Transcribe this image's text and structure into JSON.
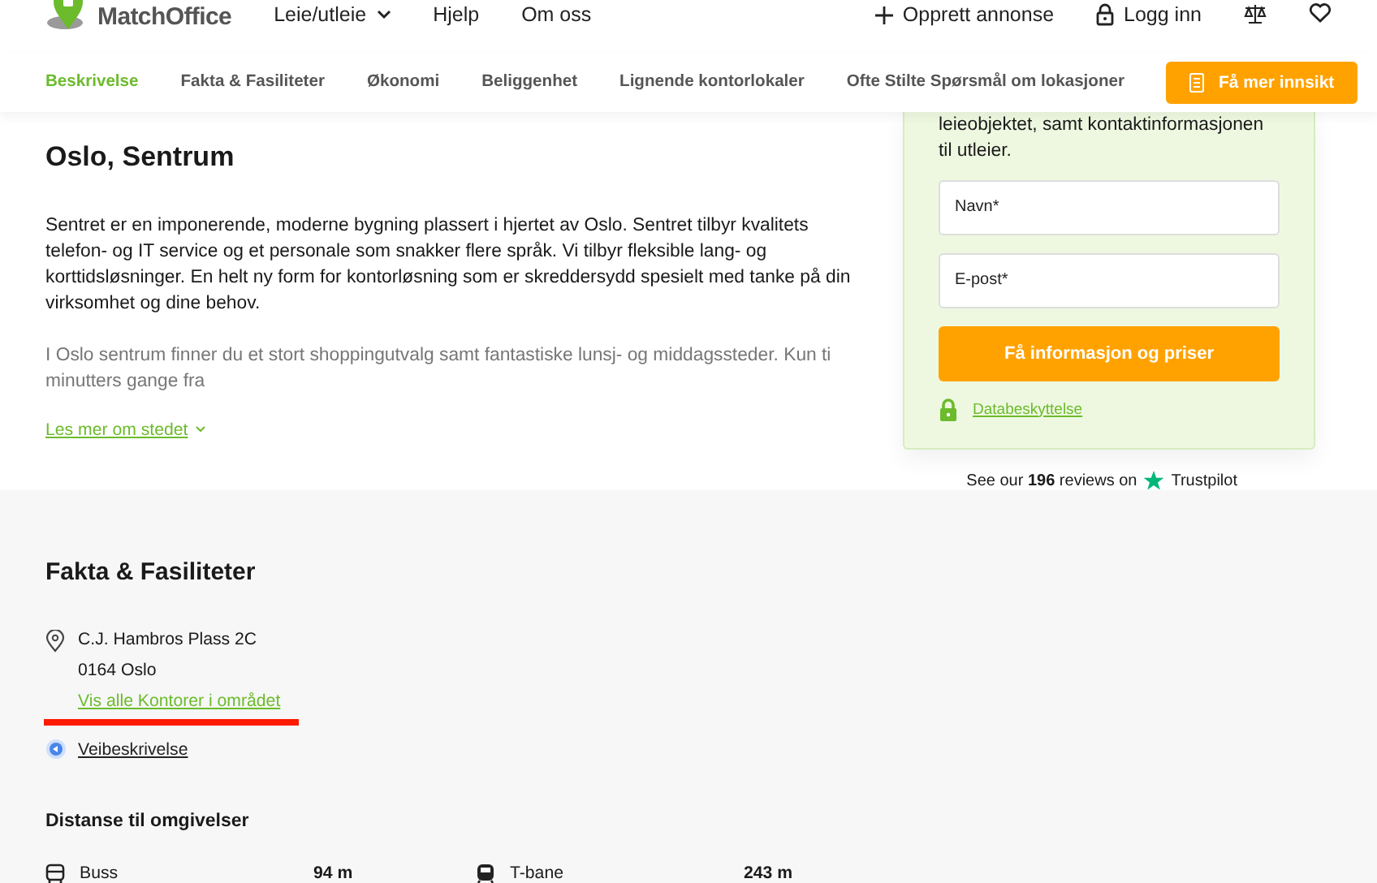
{
  "header": {
    "logo": "MatchOffice",
    "menu": [
      {
        "label": "Leie/utleie",
        "dropdown": true
      },
      {
        "label": "Hjelp",
        "dropdown": false
      },
      {
        "label": "Om oss",
        "dropdown": false
      }
    ],
    "actions": [
      {
        "kind": "add",
        "label": "Opprett annonse"
      },
      {
        "kind": "login",
        "label": "Logg inn"
      },
      {
        "kind": "compare"
      },
      {
        "kind": "favorite"
      }
    ]
  },
  "subnav": {
    "tabs": [
      {
        "label": "Beskrivelse",
        "selected": true
      },
      {
        "label": "Fakta & Fasiliteter",
        "selected": false
      },
      {
        "label": "Økonomi",
        "selected": false
      },
      {
        "label": "Beliggenhet",
        "selected": false
      },
      {
        "label": "Lignende kontorlokaler",
        "selected": false
      },
      {
        "label": "Ofte Stilte Spørsmål om lokasjoner",
        "selected": false
      }
    ],
    "cta": "Få mer innsikt"
  },
  "description": {
    "title": "Oslo, Sentrum",
    "paragraph": "Sentret er en imponerende, moderne bygning plassert i hjertet av Oslo. Sentret tilbyr kvalitets telefon- og IT service og et personale som snakker flere språk. Vi tilbyr fleksible lang- og korttidsløsninger. En helt ny form for kontorløsning som er skreddersydd spesielt med tanke på din virksomhet og dine behov.",
    "faded_paragraph": "I Oslo sentrum finner du et stort shoppingutvalg samt fantastiske lunsj- og middagssteder. Kun ti minutters gange fra",
    "read_more": "Les mer om stedet"
  },
  "form": {
    "intro": "leieobjektet, samt kontaktinformasjonen til utleier.",
    "fields": [
      {
        "placeholder": "Navn*"
      },
      {
        "placeholder": "E-post*"
      }
    ],
    "submit": "Få informasjon og priser",
    "privacy": "Databeskyttelse"
  },
  "trustpilot": {
    "text": "See our **196** reviews on",
    "brand": "Trustpilot"
  },
  "facts": {
    "title": "Fakta & Fasiliteter",
    "address_line_1": "C.J. Hambros Plass 2C",
    "address_line_2": "0164 Oslo",
    "area_link": "Vis alle Kontorer i området",
    "directions": "Veibeskrivelse",
    "distance_title": "Distanse til omgivelser",
    "distances": [
      {
        "kind": "bus",
        "name": "Buss",
        "value": "94 m"
      },
      {
        "kind": "metro",
        "name": "T-bane",
        "value": "243 m"
      }
    ]
  }
}
